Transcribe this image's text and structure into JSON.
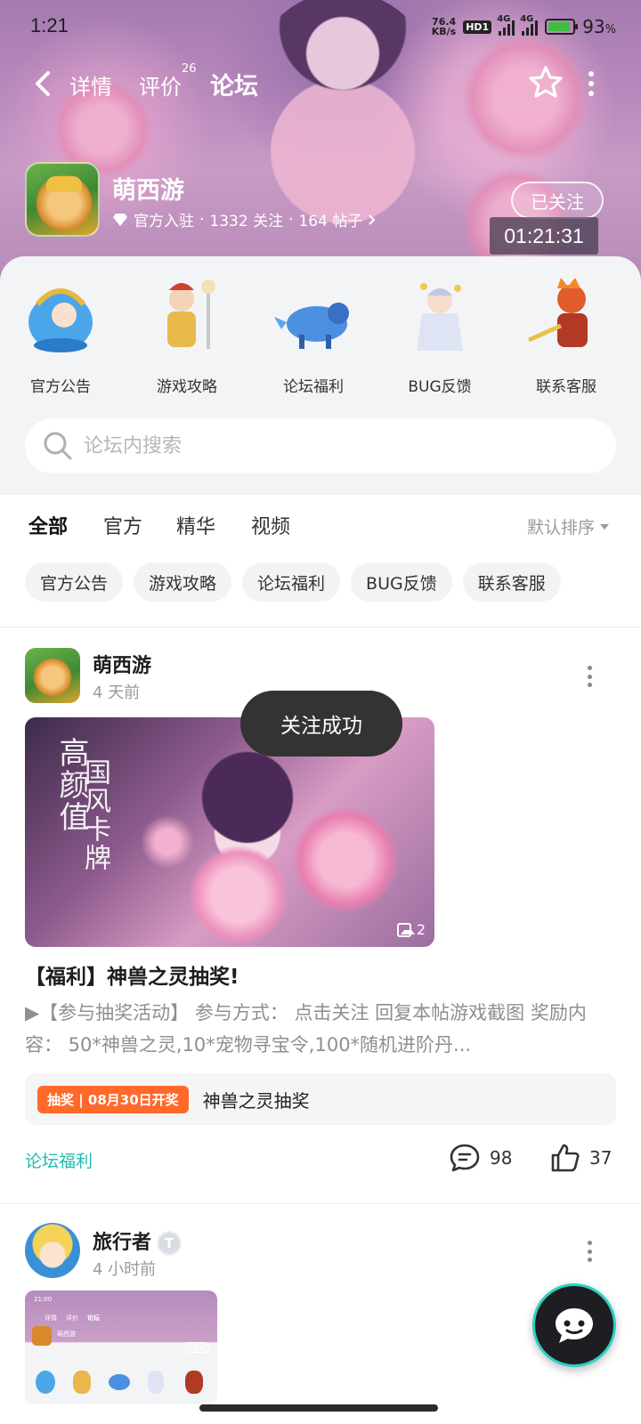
{
  "status_bar": {
    "time": "1:21",
    "net_speed_value": "76.4",
    "net_speed_unit": "KB/s",
    "hd_label": "HD1",
    "signal_1": "4G",
    "signal_2": "4G",
    "battery": "93",
    "battery_unit": "%"
  },
  "nav": {
    "tabs": [
      {
        "label": "详情"
      },
      {
        "label": "评价"
      },
      {
        "label": "论坛"
      }
    ],
    "review_count": "26",
    "active_tab": "论坛"
  },
  "game": {
    "name": "萌西游",
    "official": "官方入驻",
    "followers": "1332 关注",
    "posts": "164 帖子",
    "separator": "·",
    "follow_state": "已关注",
    "timer": "01:21:31"
  },
  "categories": [
    {
      "label": "官方公告"
    },
    {
      "label": "游戏攻略"
    },
    {
      "label": "论坛福利"
    },
    {
      "label": "BUG反馈"
    },
    {
      "label": "联系客服"
    }
  ],
  "search": {
    "placeholder": "论坛内搜索"
  },
  "filter_tabs": [
    {
      "label": "全部"
    },
    {
      "label": "官方"
    },
    {
      "label": "精华"
    },
    {
      "label": "视频"
    }
  ],
  "sort_label": "默认排序",
  "chips": [
    {
      "label": "官方公告"
    },
    {
      "label": "游戏攻略"
    },
    {
      "label": "论坛福利"
    },
    {
      "label": "BUG反馈"
    },
    {
      "label": "联系客服"
    }
  ],
  "posts": [
    {
      "author": "萌西游",
      "time": "4 天前",
      "image_text_1": "高颜值",
      "image_text_2": "国风卡牌",
      "image_count": "2",
      "title": "【福利】神兽之灵抽奖!",
      "body": "▶【参与抽奖活动】 参与方式： 点击关注 回复本帖游戏截图 奖励内容： 50*神兽之灵,10*宠物寻宝令,100*随机进阶丹...",
      "lottery_tag": "抽奖 | 08月30日开奖",
      "lottery_name": "神兽之灵抽奖",
      "category": "论坛福利",
      "comments": "98",
      "likes": "37"
    },
    {
      "author": "旅行者",
      "badge": "T",
      "time": "4 小时前"
    }
  ],
  "toast": "关注成功",
  "thumb": {
    "time": "21:00",
    "tabs": [
      "详情",
      "评价",
      "论坛"
    ],
    "name": "萌西游",
    "follow": "已关注"
  },
  "colors": {
    "accent": "#22c6b4",
    "lottery": "#ff6a2b",
    "category_link": "#1fbcae"
  }
}
